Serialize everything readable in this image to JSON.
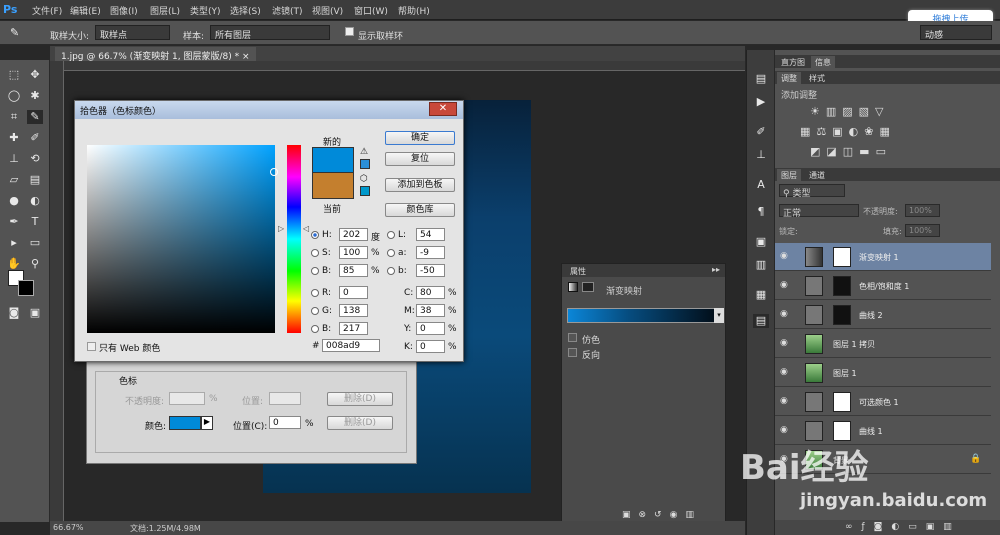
{
  "app": {
    "logo": "Ps"
  },
  "menu": [
    "文件(F)",
    "编辑(E)",
    "图像(I)",
    "图层(L)",
    "类型(Y)",
    "选择(S)",
    "滤镜(T)",
    "视图(V)",
    "窗口(W)",
    "帮助(H)"
  ],
  "options": {
    "sample_size_label": "取样大小:",
    "sample_size_value": "取样点",
    "sample_label": "样本:",
    "sample_value": "所有图层",
    "show_ring_label": "显示取样环",
    "workspace": "动感"
  },
  "upload_button": "拖拽上传",
  "document_tab": "1.jpg @ 66.7% (渐变映射 1, 图层蒙版/8) *",
  "status": {
    "zoom": "66.67%",
    "doc": "文档:1.25M/4.98M"
  },
  "color_picker": {
    "title": "拾色器（色标颜色）",
    "new_label": "新的",
    "current_label": "当前",
    "new_color": "#008ad9",
    "current_color": "#c47f2e",
    "buttons": {
      "ok": "确定",
      "reset": "复位",
      "add_swatch": "添加到色板",
      "libraries": "颜色库"
    },
    "web_only": "只有 Web 颜色",
    "fields": {
      "H": {
        "label": "H:",
        "value": "202",
        "unit": "度"
      },
      "S": {
        "label": "S:",
        "value": "100",
        "unit": "%"
      },
      "B": {
        "label": "B:",
        "value": "85",
        "unit": "%"
      },
      "R": {
        "label": "R:",
        "value": "0"
      },
      "G": {
        "label": "G:",
        "value": "138"
      },
      "Bv": {
        "label": "B:",
        "value": "217"
      },
      "L": {
        "label": "L:",
        "value": "54"
      },
      "a": {
        "label": "a:",
        "value": "-9"
      },
      "b": {
        "label": "b:",
        "value": "-50"
      },
      "C": {
        "label": "C:",
        "value": "80",
        "unit": "%"
      },
      "M": {
        "label": "M:",
        "value": "38",
        "unit": "%"
      },
      "Y": {
        "label": "Y:",
        "value": "0",
        "unit": "%"
      },
      "K": {
        "label": "K:",
        "value": "0",
        "unit": "%"
      }
    },
    "hex_label": "#",
    "hex_value": "008ad9"
  },
  "gradient_editor": {
    "group_label": "色标",
    "opacity_label": "不透明度:",
    "opacity_unit": "%",
    "position_label": "位置:",
    "delete_label": "删除(D)",
    "color_label": "颜色:",
    "position_c_label": "位置(C):",
    "position_c_value": "0",
    "position_c_unit": "%",
    "delete_label_2": "删除(D)"
  },
  "properties": {
    "tab": "属性",
    "title": "渐变映射",
    "dither": "仿色",
    "reverse": "反向"
  },
  "right_panel": {
    "tabs_top": [
      "直方图",
      "信息"
    ],
    "tabs_adj": [
      "调整",
      "样式"
    ],
    "add_adjustment": "添加调整",
    "tabs_layers": [
      "图层",
      "通道"
    ],
    "kind_filter": "类型",
    "blend_mode": "正常",
    "opacity_label": "不透明度:",
    "opacity_value": "100%",
    "lock_label": "锁定:",
    "fill_label": "填充:",
    "fill_value": "100%",
    "layers": [
      {
        "name": "渐变映射 1",
        "selected": true
      },
      {
        "name": "色相/饱和度 1",
        "selected": false
      },
      {
        "name": "曲线 2",
        "selected": false
      },
      {
        "name": "图层 1 拷贝",
        "selected": false
      },
      {
        "name": "图层 1",
        "selected": false
      },
      {
        "name": "可选颜色 1",
        "selected": false
      },
      {
        "name": "曲线 1",
        "selected": false
      },
      {
        "name": "背景",
        "selected": false
      }
    ]
  },
  "watermark": {
    "logo": "Bai经验",
    "url": "jingyan.baidu.com"
  }
}
